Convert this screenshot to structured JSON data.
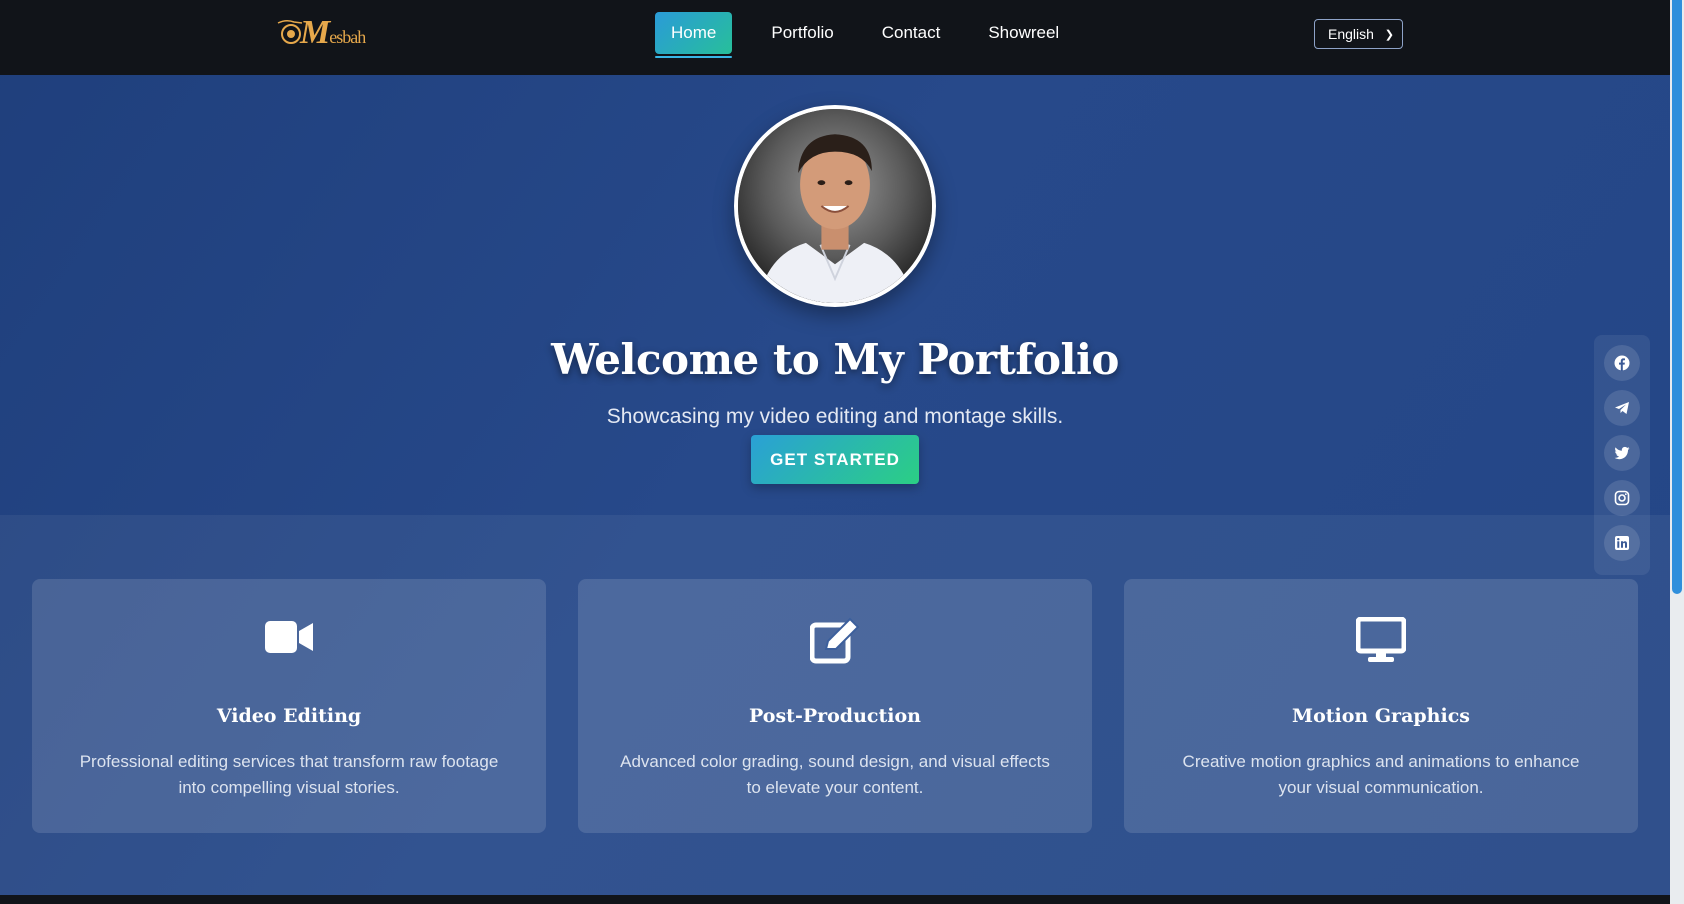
{
  "navbar": {
    "logo": {
      "initial": "M",
      "rest": "esbah"
    },
    "links": [
      {
        "label": "Home",
        "active": true
      },
      {
        "label": "Portfolio",
        "active": false
      },
      {
        "label": "Contact",
        "active": false
      },
      {
        "label": "Showreel",
        "active": false
      }
    ],
    "language": "English"
  },
  "hero": {
    "title": "Welcome to My Portfolio",
    "subtitle": "Showcasing my video editing and montage skills.",
    "cta_label": "GET STARTED"
  },
  "services": [
    {
      "icon": "video-camera-icon",
      "title": "Video Editing",
      "description": "Professional editing services that transform raw footage into compelling visual stories."
    },
    {
      "icon": "edit-icon",
      "title": "Post-Production",
      "description": "Advanced color grading, sound design, and visual effects to elevate your content."
    },
    {
      "icon": "desktop-monitor-icon",
      "title": "Motion Graphics",
      "description": "Creative motion graphics and animations to enhance your visual communication."
    }
  ],
  "social": [
    {
      "icon": "facebook-icon"
    },
    {
      "icon": "telegram-icon"
    },
    {
      "icon": "twitter-icon"
    },
    {
      "icon": "instagram-icon"
    },
    {
      "icon": "linkedin-icon"
    }
  ],
  "colors": {
    "accent_gradient_start": "#2a9bd8",
    "accent_gradient_end": "#2bcf84",
    "nav_background": "#111419",
    "page_background": "#244686",
    "logo_gold": "#e6a84b"
  }
}
